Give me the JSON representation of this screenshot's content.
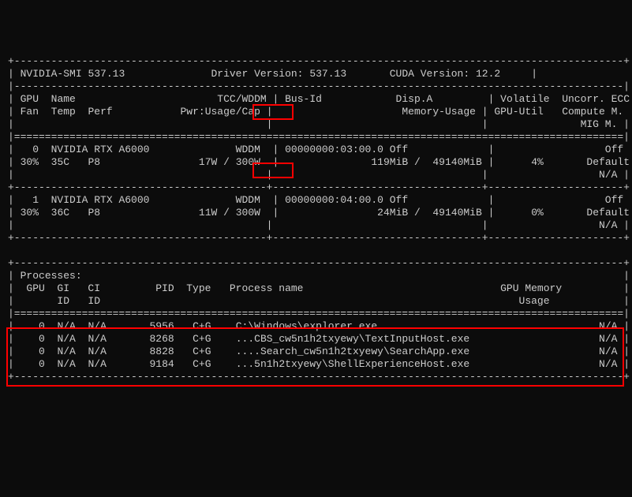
{
  "header": {
    "smi_label": "NVIDIA-SMI",
    "smi_version": "537.13",
    "driver_label": "Driver Version:",
    "driver_version": "537.13",
    "cuda_label": "CUDA Version:",
    "cuda_version": "12.2"
  },
  "cols": {
    "gpu": "GPU",
    "name": "Name",
    "tcc_wddm": "TCC/WDDM",
    "bus_id": "Bus-Id",
    "disp_a": "Disp.A",
    "volatile": "Volatile",
    "uncorr_ecc": "Uncorr. ECC",
    "fan": "Fan",
    "temp": "Temp",
    "perf": "Perf",
    "pwr": "Pwr:Usage/Cap",
    "mem_usage": "Memory-Usage",
    "gpu_util": "GPU-Util",
    "compute_m": "Compute M.",
    "mig_m": "MIG M."
  },
  "gpus": [
    {
      "idx": "0",
      "name": "NVIDIA RTX A6000",
      "mode": "WDDM",
      "bus": "00000000:03:00.0",
      "disp": "Off",
      "fan": "30%",
      "temp": "35C",
      "perf": "P8",
      "pwr_usage": "17W",
      "pwr_cap": "300W",
      "mem_used": "119MiB",
      "mem_total": "49140MiB",
      "util": "4%",
      "ecc": "Off",
      "compute": "Default",
      "mig": "N/A"
    },
    {
      "idx": "1",
      "name": "NVIDIA RTX A6000",
      "mode": "WDDM",
      "bus": "00000000:04:00.0",
      "disp": "Off",
      "fan": "30%",
      "temp": "36C",
      "perf": "P8",
      "pwr_usage": "11W",
      "pwr_cap": "300W",
      "mem_used": "24MiB",
      "mem_total": "49140MiB",
      "util": "0%",
      "ecc": "Off",
      "compute": "Default",
      "mig": "N/A"
    }
  ],
  "proc": {
    "title": "Processes:",
    "h_gpu": "GPU",
    "h_gi": "GI",
    "h_ci": "CI",
    "h_pid": "PID",
    "h_type": "Type",
    "h_name": "Process name",
    "h_mem": "GPU Memory",
    "h_id": "ID",
    "h_usage": "Usage",
    "rows": [
      {
        "gpu": "0",
        "gi": "N/A",
        "ci": "N/A",
        "pid": "5956",
        "type": "C+G",
        "name": "C:\\Windows\\explorer.exe",
        "mem": "N/A"
      },
      {
        "gpu": "0",
        "gi": "N/A",
        "ci": "N/A",
        "pid": "8268",
        "type": "C+G",
        "name": "...CBS_cw5n1h2txyewy\\TextInputHost.exe",
        "mem": "N/A"
      },
      {
        "gpu": "0",
        "gi": "N/A",
        "ci": "N/A",
        "pid": "8828",
        "type": "C+G",
        "name": "....Search_cw5n1h2txyewy\\SearchApp.exe",
        "mem": "N/A"
      },
      {
        "gpu": "0",
        "gi": "N/A",
        "ci": "N/A",
        "pid": "9184",
        "type": "C+G",
        "name": "...5n1h2txyewy\\ShellExperienceHost.exe",
        "mem": "N/A"
      }
    ]
  }
}
